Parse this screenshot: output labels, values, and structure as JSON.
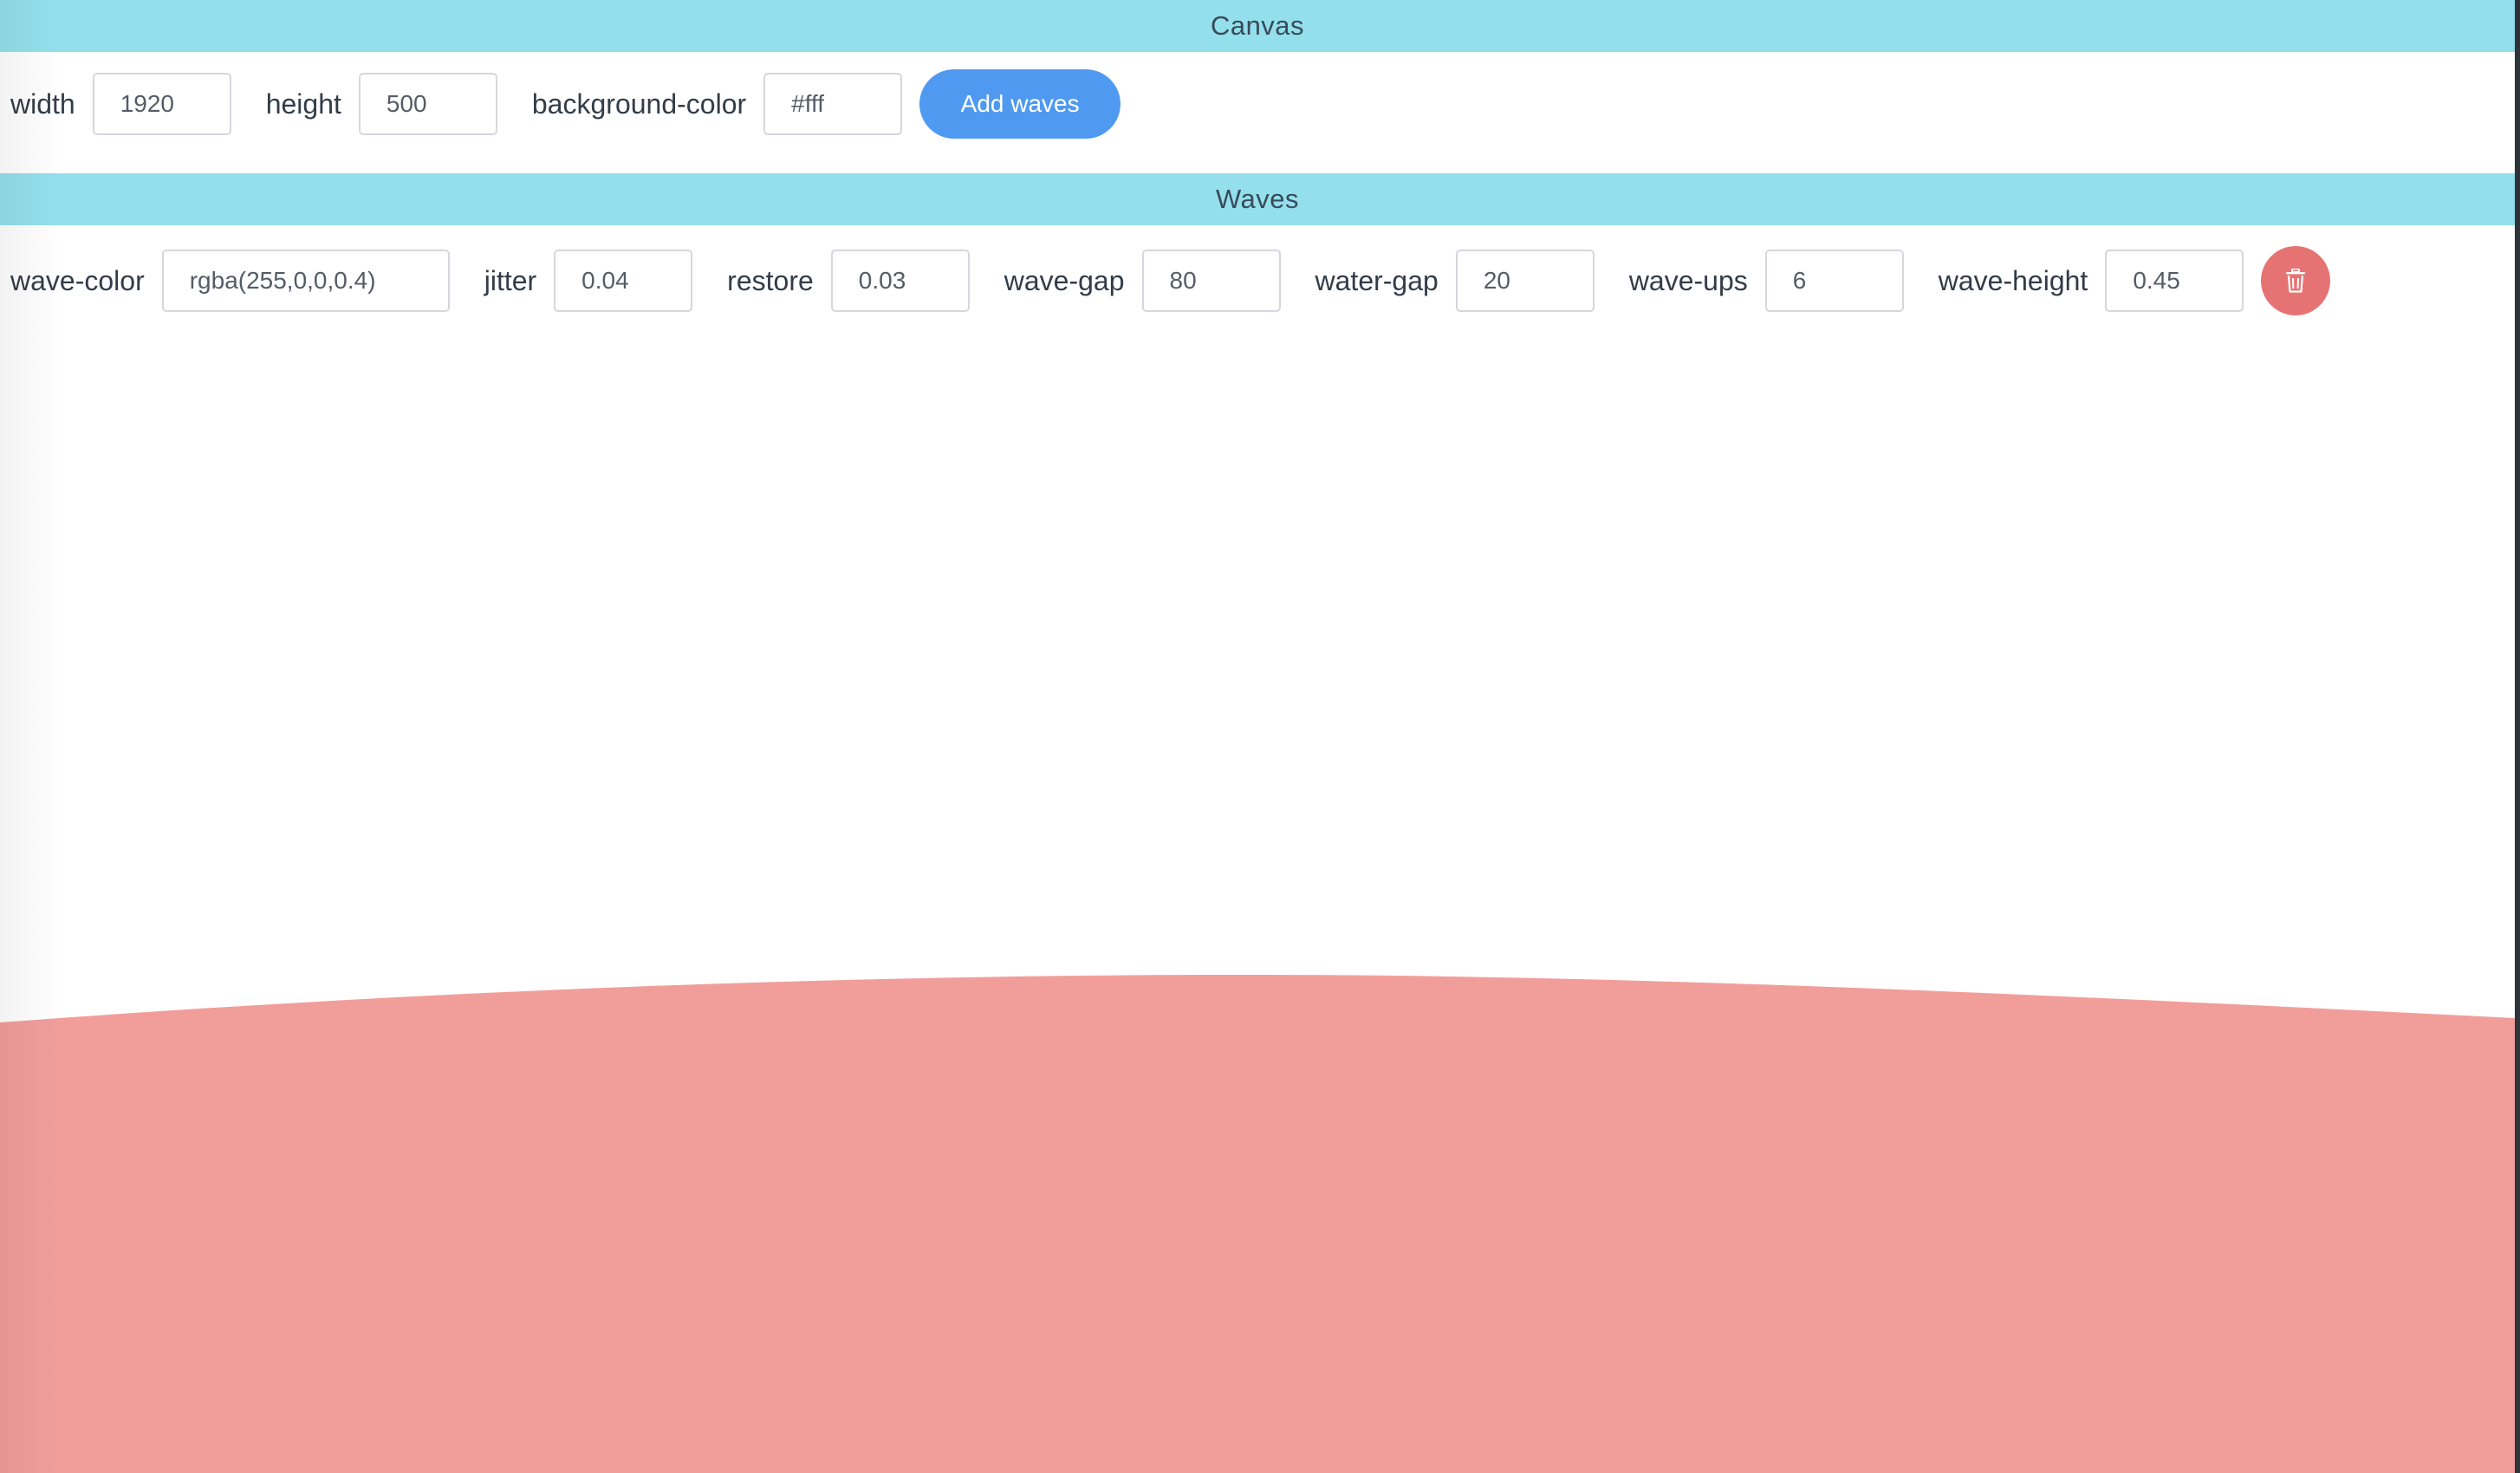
{
  "canvas_section": {
    "title": "Canvas",
    "width_label": "width",
    "width_value": "1920",
    "height_label": "height",
    "height_value": "500",
    "background_label": "background-color",
    "background_value": "#fff",
    "add_waves_label": "Add waves"
  },
  "waves_section": {
    "title": "Waves",
    "wave_color_label": "wave-color",
    "wave_color_value": "rgba(255,0,0,0.4)",
    "jitter_label": "jitter",
    "jitter_value": "0.04",
    "restore_label": "restore",
    "restore_value": "0.03",
    "wave_gap_label": "wave-gap",
    "wave_gap_value": "80",
    "water_gap_label": "water-gap",
    "water_gap_value": "20",
    "wave_ups_label": "wave-ups",
    "wave_ups_value": "6",
    "wave_height_label": "wave-height",
    "wave_height_value": "0.45",
    "delete_icon": "trash-icon"
  },
  "colors": {
    "header_bg": "#93e0ec",
    "primary_button": "#4f9af0",
    "danger_button": "#e67373",
    "wave_fill": "rgba(255,0,0,0.4)",
    "canvas_background": "#fff"
  }
}
